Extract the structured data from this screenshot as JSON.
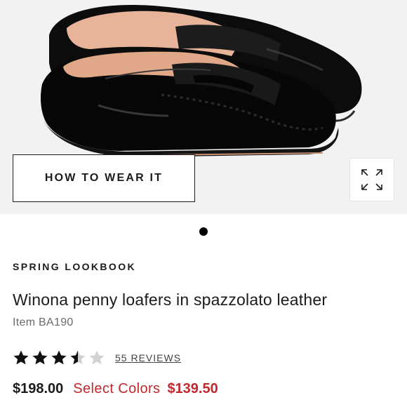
{
  "hero": {
    "image_subject": "black penny loafers",
    "wear_button_label": "HOW TO WEAR IT",
    "expand_icon": "expand-icon",
    "carousel_active_index": 1,
    "carousel_total": 1
  },
  "product": {
    "collection": "SPRING LOOKBOOK",
    "name": "Winona penny loafers in spazzolato leather",
    "item_code": "Item BA190",
    "rating": 3.5,
    "rating_max": 5,
    "reviews_label": "55 REVIEWS",
    "price": "$198.00",
    "select_colors_label": "Select Colors",
    "sale_price": "$139.50"
  },
  "colors": {
    "sale_red": "#c0282d",
    "text_dark": "#1b1b1b",
    "hero_bg": "#f2f2f2"
  }
}
